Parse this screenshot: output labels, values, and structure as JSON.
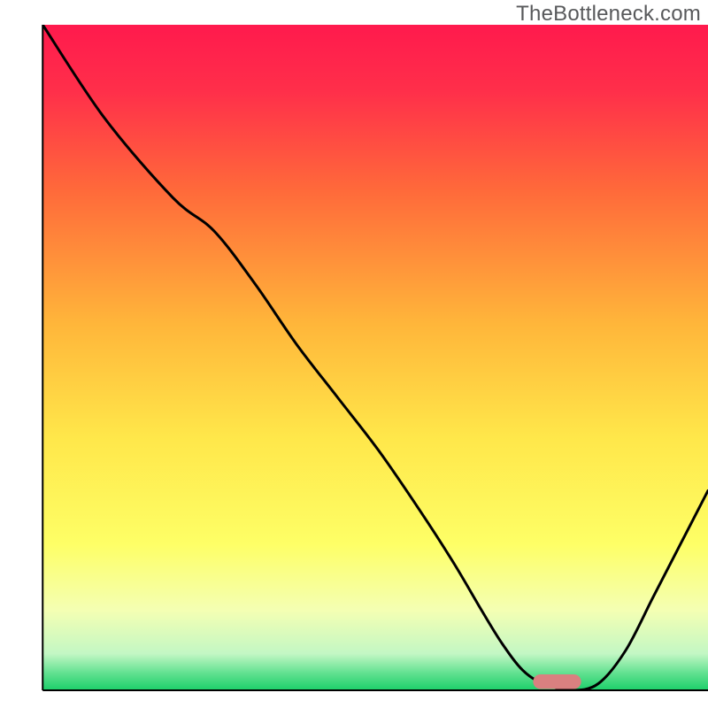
{
  "watermark": "TheBottleneck.com",
  "chart_data": {
    "type": "line",
    "title": "",
    "xlabel": "",
    "ylabel": "",
    "xlim": [
      0,
      100
    ],
    "ylim": [
      0,
      100
    ],
    "grid": false,
    "legend": false,
    "gradient_stops": [
      {
        "offset": 0.0,
        "color": "#ff1a4d"
      },
      {
        "offset": 0.1,
        "color": "#ff2f4a"
      },
      {
        "offset": 0.25,
        "color": "#ff6a3a"
      },
      {
        "offset": 0.45,
        "color": "#ffb63a"
      },
      {
        "offset": 0.62,
        "color": "#ffe74a"
      },
      {
        "offset": 0.78,
        "color": "#feff66"
      },
      {
        "offset": 0.88,
        "color": "#f4ffb3"
      },
      {
        "offset": 0.945,
        "color": "#c3f7c4"
      },
      {
        "offset": 0.975,
        "color": "#5fe08f"
      },
      {
        "offset": 1.0,
        "color": "#1ccf6a"
      }
    ],
    "series": [
      {
        "name": "bottleneck-curve",
        "color": "#000000",
        "x": [
          3,
          12,
          22,
          28,
          34,
          40,
          46,
          52,
          58,
          63,
          67,
          70,
          73,
          76,
          80,
          84,
          88,
          92,
          96,
          100
        ],
        "y": [
          100,
          86,
          74,
          69,
          61,
          52,
          44,
          36,
          27,
          19,
          12,
          7,
          3,
          1,
          0,
          1,
          6,
          14,
          22,
          30
        ]
      }
    ],
    "marker": {
      "name": "optimal-zone",
      "shape": "rounded-rect",
      "color": "#d98080",
      "x_center": 78,
      "y_center": 1.3,
      "width": 7,
      "height": 2.2
    },
    "axes": {
      "left": {
        "x": 3,
        "y0": 0,
        "y1": 100
      },
      "bottom": {
        "y": 0,
        "x0": 3,
        "x1": 100
      }
    }
  }
}
